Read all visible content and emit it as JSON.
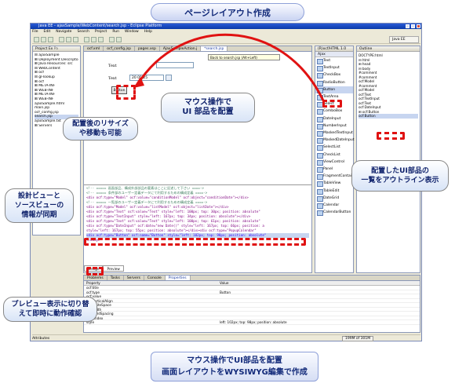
{
  "title": "ページレイアウト作成",
  "window": {
    "title": "Java EE - ajaxSample/WebContent/search.jsp - Eclipse Platform",
    "menu": [
      "File",
      "Edit",
      "Navigate",
      "Search",
      "Project",
      "Run",
      "Window",
      "Help"
    ],
    "perspective": "Java EE"
  },
  "project_explorer": {
    "tab": "Project Ex",
    "tab2": "Pa",
    "tree": [
      "⊟ ajaxSample",
      "  ⊞ Deployment Descripto",
      "  ⊞ Java Resources: src",
      "  ⊟ WebContent",
      "    ⊞ ocf",
      "    ⊟ gl-lookup",
      "       ⊞ ocf",
      "       ⊞ META-INF",
      "       ⊞ WEB-INF",
      "    ⊞ META-INF",
      "    ⊞ WEB-INF",
      "       ajaxSample.html",
      "       main.jsp",
      "       ocf_config.jsp",
      "       search.jsp",
      "    ajaxSample.txt",
      "  ⊞ Servers"
    ]
  },
  "editor": {
    "tabs": [
      "ocf.xml",
      "ocf_config.jsp",
      "pages.xsp",
      "AjaxSampleAction.j",
      "*search.jsp"
    ],
    "design_labels": [
      "Text",
      "Text"
    ],
    "date_value": "20  05/25",
    "button_label": "Button",
    "design_hint": "Back to search.jsp (Alt+Left)",
    "source_lines": [
      "<!-- ===== 画面部品、構成外部部品の要素はここに記述して下さい ====->",
      "<!-- ===== 条件部のユーザー定義データにて利用するための構成定義 ====->",
      "<div ocf:type=\"Model\" ocf:value=\"conditionModel\" ocf:object=\"conditionDate\"></div>",
      "<!-- ===== 一覧部のユーザー定義データにて利用するための構成定義 ====->",
      "<div ocf:type=\"Model\" ocf:value=\"listModel\" ocf:object=\"listDate\"></div>",
      "",
      "<div ocf:type=\"Text\" ocf:value=\"Text\" style=\"left: 100px; top: 30px; position: absolute\"",
      "<div ocf:type=\"TextInput\" style=\"left: 167px; top: 34px; position: absolute\"></div>",
      "<div ocf:type=\"Text\" ocf:value=\"Text\" style=\"left: 100px; top: 61px; position: absolute\"",
      "<div ocf:type=\"DateInput\" ocf:date=\"new Date()\" style=\"left: 167px; top: 66px; position: a",
      "    style=\"left: 167px; top: 55px; position: absolute\"></div><div ocf:type=\"PopupCalendar\"",
      "",
      "<div ocf:type=\"Button\" ocf:name=\"Button\" style=\"left: 102px; top: 98px; position: absolute\"",
      "</body>"
    ],
    "view_tabs": [
      "Design",
      "Preview"
    ]
  },
  "palette": {
    "tab": "(R)ocf/HTML 1.0",
    "group": "Ajax",
    "items": [
      "Text",
      "TextInput",
      "CheckBox",
      "RadioButton",
      "Button",
      "TextArea",
      "Select",
      "ComboBox",
      "DateInput",
      "NumberInput",
      "MaskedTextInput",
      "MaskedDateInput",
      "SelectList",
      "CheckList",
      "ViewControl",
      "Panel",
      "FragmentContainer",
      "TableView",
      "TableEdit",
      "DateGrid",
      "Calendar",
      "CalendarButton"
    ]
  },
  "outline": {
    "tab": "Outline",
    "tree": [
      "DOCTYPE:html",
      "⊟ html",
      "  ⊞ head",
      "  ⊟ body",
      "     #comment",
      "     #comment",
      "     ocf:Model",
      "     #comment",
      "     ocf:Model",
      "     ocf:Text",
      "     ocf:TextInput",
      "     ocf:Text",
      "     ocf:DateInput",
      "     ⊞ ocf:Button",
      "     ocf:Button"
    ]
  },
  "bottom_panel": {
    "tabs": [
      "Problems",
      "Tasks",
      "Servers",
      "Console",
      "Properties"
    ],
    "headers": [
      "Property",
      "Value"
    ],
    "rows": [
      [
        "ocf:title",
        ""
      ],
      [
        "ocf:type",
        "Button"
      ],
      [
        "ocf:value",
        ""
      ],
      [
        "ocf:verticalAlign",
        ""
      ],
      [
        "ocf:whiteSpace",
        ""
      ],
      [
        "ocf:width",
        ""
      ],
      [
        "ocf:wordSpacing",
        ""
      ],
      [
        "ocf:zIndex",
        ""
      ],
      [
        "style",
        "left: 102px; top: 98px; position: absolute"
      ]
    ],
    "section": "Attributes"
  },
  "status": {
    "left": "",
    "memory": "199M of 301M"
  },
  "callouts": {
    "ui_place": [
      "マウス操作で",
      "UI 部品を配置"
    ],
    "resize": [
      "配置後のリサイズ",
      "や移動も可能"
    ],
    "sync": [
      "設計ビューと",
      "ソースビューの",
      "情報が同期"
    ],
    "outline": [
      "配置したUI部品の",
      "一覧をアウトライン表示"
    ],
    "preview": [
      "プレビュー表示に切り替",
      "えて即時に動作確認"
    ]
  },
  "bottom_caption": [
    "マウス操作でUI部品を配置",
    "画面レイアウトをWYSIWYG編集で作成"
  ]
}
